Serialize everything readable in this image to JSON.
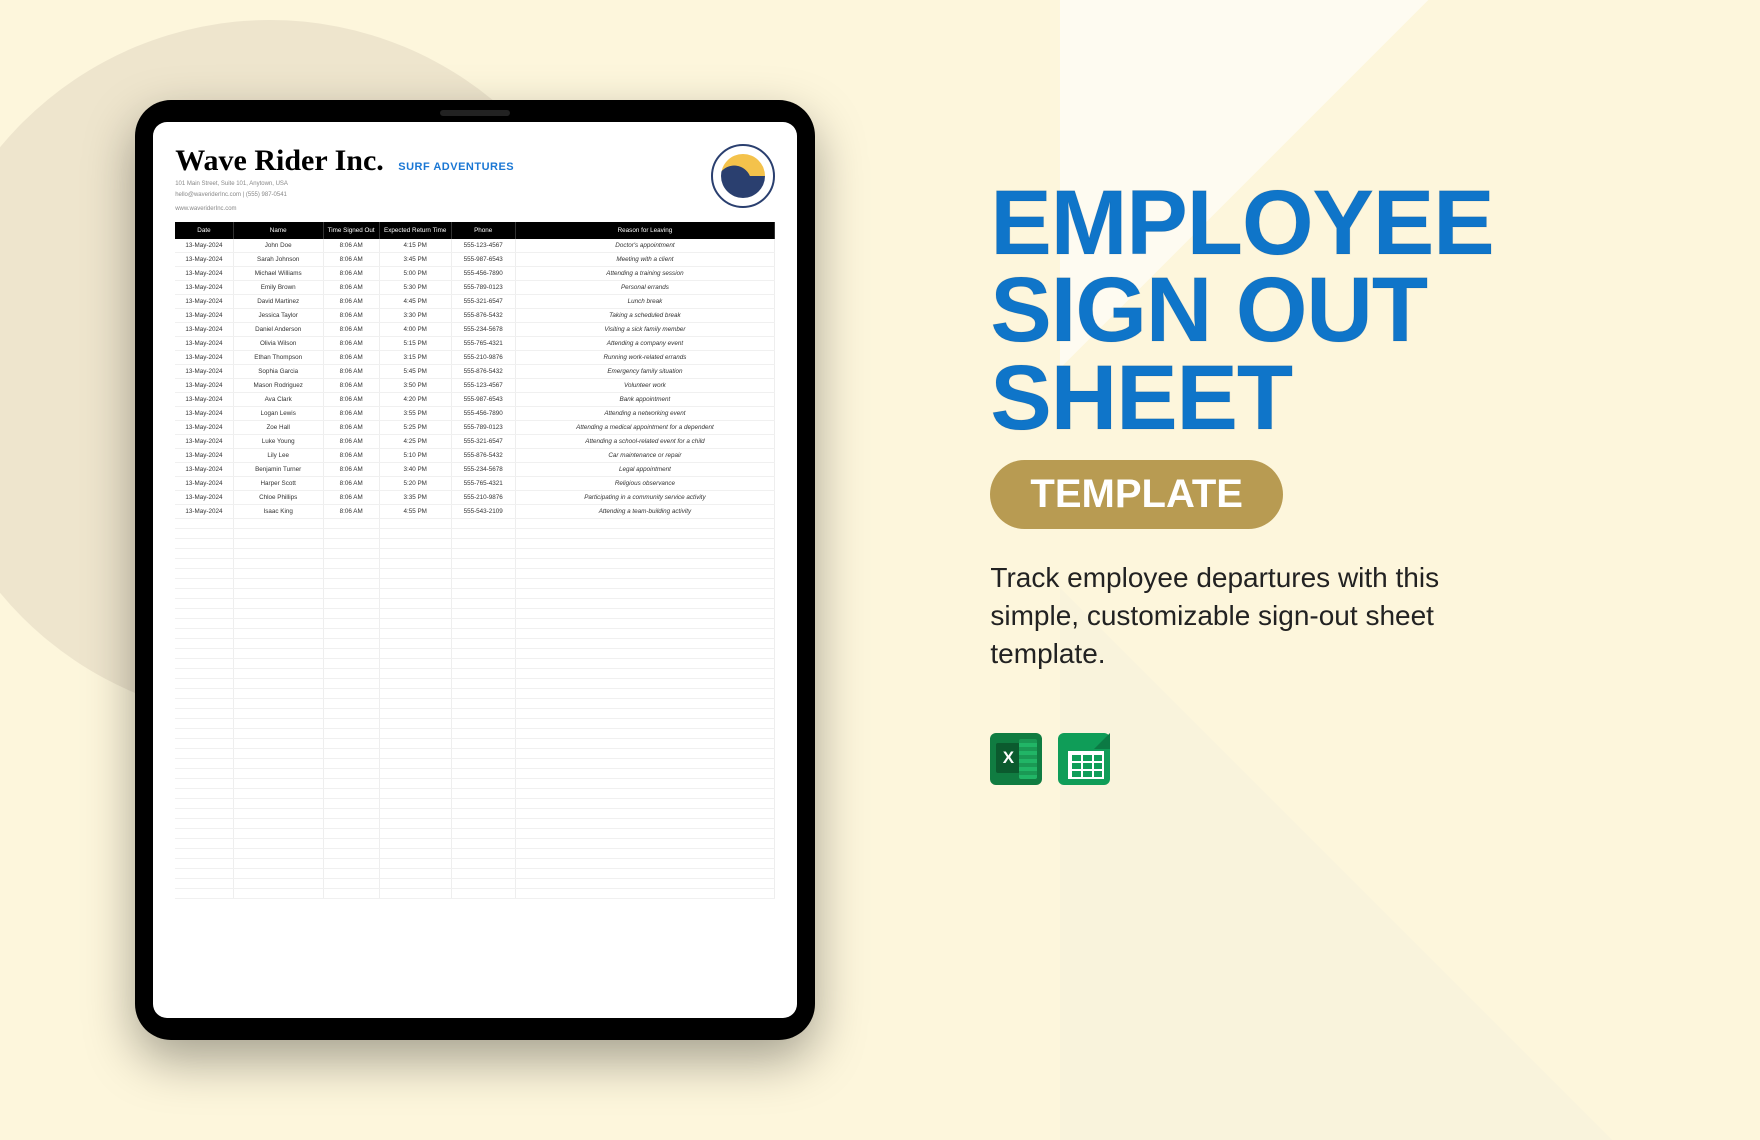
{
  "hero": {
    "title_l1": "EMPLOYEE",
    "title_l2": "SIGN OUT",
    "title_l3": "SHEET",
    "badge": "TEMPLATE",
    "description": "Track employee departures with this simple, customizable sign-out sheet template."
  },
  "doc": {
    "company": "Wave Rider Inc.",
    "tagline": "SURF ADVENTURES",
    "address_l1": "101 Main Street, Suite 101, Anytown, USA",
    "address_l2": "hello@waveriderInc.com | (555) 987-0541",
    "website": "www.waveriderInc.com",
    "columns": [
      "Date",
      "Name",
      "Time Signed Out",
      "Expected Return Time",
      "Phone",
      "Reason for Leaving"
    ],
    "rows": [
      {
        "date": "13-May-2024",
        "name": "John Doe",
        "out": "8:06 AM",
        "ret": "4:15 PM",
        "phone": "555-123-4567",
        "reason": "Doctor's appointment"
      },
      {
        "date": "13-May-2024",
        "name": "Sarah Johnson",
        "out": "8:06 AM",
        "ret": "3:45 PM",
        "phone": "555-987-6543",
        "reason": "Meeting with a client"
      },
      {
        "date": "13-May-2024",
        "name": "Michael Williams",
        "out": "8:06 AM",
        "ret": "5:00 PM",
        "phone": "555-456-7890",
        "reason": "Attending a training session"
      },
      {
        "date": "13-May-2024",
        "name": "Emily Brown",
        "out": "8:06 AM",
        "ret": "5:30 PM",
        "phone": "555-789-0123",
        "reason": "Personal errands"
      },
      {
        "date": "13-May-2024",
        "name": "David Martinez",
        "out": "8:06 AM",
        "ret": "4:45 PM",
        "phone": "555-321-6547",
        "reason": "Lunch break"
      },
      {
        "date": "13-May-2024",
        "name": "Jessica Taylor",
        "out": "8:06 AM",
        "ret": "3:30 PM",
        "phone": "555-876-5432",
        "reason": "Taking a scheduled break"
      },
      {
        "date": "13-May-2024",
        "name": "Daniel Anderson",
        "out": "8:06 AM",
        "ret": "4:00 PM",
        "phone": "555-234-5678",
        "reason": "Visiting a sick family member"
      },
      {
        "date": "13-May-2024",
        "name": "Olivia Wilson",
        "out": "8:06 AM",
        "ret": "5:15 PM",
        "phone": "555-765-4321",
        "reason": "Attending a company event"
      },
      {
        "date": "13-May-2024",
        "name": "Ethan Thompson",
        "out": "8:06 AM",
        "ret": "3:15 PM",
        "phone": "555-210-9876",
        "reason": "Running work-related errands"
      },
      {
        "date": "13-May-2024",
        "name": "Sophia Garcia",
        "out": "8:06 AM",
        "ret": "5:45 PM",
        "phone": "555-876-5432",
        "reason": "Emergency family situation"
      },
      {
        "date": "13-May-2024",
        "name": "Mason Rodriguez",
        "out": "8:06 AM",
        "ret": "3:50 PM",
        "phone": "555-123-4567",
        "reason": "Volunteer work"
      },
      {
        "date": "13-May-2024",
        "name": "Ava Clark",
        "out": "8:06 AM",
        "ret": "4:20 PM",
        "phone": "555-987-6543",
        "reason": "Bank appointment"
      },
      {
        "date": "13-May-2024",
        "name": "Logan Lewis",
        "out": "8:06 AM",
        "ret": "3:55 PM",
        "phone": "555-456-7890",
        "reason": "Attending a networking event"
      },
      {
        "date": "13-May-2024",
        "name": "Zoe Hall",
        "out": "8:06 AM",
        "ret": "5:25 PM",
        "phone": "555-789-0123",
        "reason": "Attending a medical appointment for a dependent"
      },
      {
        "date": "13-May-2024",
        "name": "Luke Young",
        "out": "8:06 AM",
        "ret": "4:25 PM",
        "phone": "555-321-6547",
        "reason": "Attending a school-related event for a child"
      },
      {
        "date": "13-May-2024",
        "name": "Lily Lee",
        "out": "8:06 AM",
        "ret": "5:10 PM",
        "phone": "555-876-5432",
        "reason": "Car maintenance or repair"
      },
      {
        "date": "13-May-2024",
        "name": "Benjamin Turner",
        "out": "8:06 AM",
        "ret": "3:40 PM",
        "phone": "555-234-5678",
        "reason": "Legal appointment"
      },
      {
        "date": "13-May-2024",
        "name": "Harper Scott",
        "out": "8:06 AM",
        "ret": "5:20 PM",
        "phone": "555-765-4321",
        "reason": "Religious observance"
      },
      {
        "date": "13-May-2024",
        "name": "Chloe Phillips",
        "out": "8:06 AM",
        "ret": "3:35 PM",
        "phone": "555-210-9876",
        "reason": "Participating in a community service activity"
      },
      {
        "date": "13-May-2024",
        "name": "Isaac King",
        "out": "8:06 AM",
        "ret": "4:55 PM",
        "phone": "555-543-2109",
        "reason": "Attending a team-building activity"
      }
    ],
    "empty_rows": 38
  }
}
